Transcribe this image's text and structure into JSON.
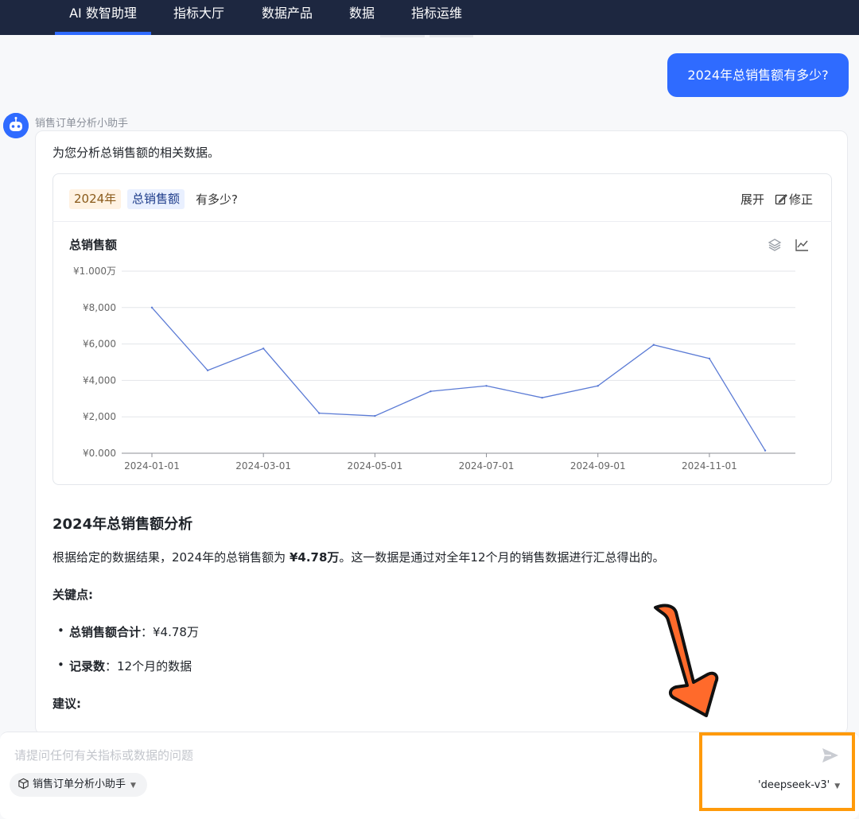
{
  "nav": {
    "items": [
      "AI 数智助理",
      "指标大厅",
      "数据产品",
      "数据",
      "指标运维"
    ],
    "active_index": 0
  },
  "user_message": "2024年总销售额有多少?",
  "assistant": {
    "name": "销售订单分析小助手",
    "intro": "为您分析总销售额的相关数据。"
  },
  "query_card": {
    "tag_year": "2024年",
    "tag_metric": "总销售额",
    "suffix": "有多少?",
    "expand_label": "展开",
    "edit_label": "修正",
    "chart_title": "总销售额"
  },
  "chart_data": {
    "type": "line",
    "title": "总销售额",
    "x": [
      "2024-01-01",
      "2024-02-01",
      "2024-03-01",
      "2024-04-01",
      "2024-05-01",
      "2024-06-01",
      "2024-07-01",
      "2024-08-01",
      "2024-09-01",
      "2024-10-01",
      "2024-11-01",
      "2024-12-01"
    ],
    "x_tick_labels": [
      "2024-01-01",
      "2024-03-01",
      "2024-05-01",
      "2024-07-01",
      "2024-09-01",
      "2024-11-01"
    ],
    "values": [
      8000,
      4550,
      5750,
      2200,
      2050,
      3400,
      3700,
      3050,
      3700,
      5950,
      5200,
      150
    ],
    "y_tick_labels": [
      "¥0.000",
      "¥2,000",
      "¥4,000",
      "¥6,000",
      "¥8,000",
      "¥1.000万"
    ],
    "ylim": [
      0,
      10000
    ],
    "grid": true,
    "color": "#5b7bd5"
  },
  "analysis": {
    "title": "2024年总销售额分析",
    "p_before": "根据给定的数据结果，2024年的总销售额为 ",
    "p_bold": "¥4.78万",
    "p_after": "。这一数据是通过对全年12个月的销售数据进行汇总得出的。",
    "key_title": "关键点:",
    "bullets": [
      {
        "label": "总销售额合计",
        "text": "：¥4.78万"
      },
      {
        "label": "记录数",
        "text": "：12个月的数据"
      }
    ],
    "suggest_title": "建议:"
  },
  "input": {
    "placeholder": "请提问任何有关指标或数据的问题",
    "assistant_select": "销售订单分析小助手",
    "model": "'deepseek-v3'"
  },
  "colors": {
    "nav_bg": "#1d2740",
    "accent": "#2f6bff",
    "highlight": "#ff9a0a",
    "arrow": "#ff6a2b"
  }
}
